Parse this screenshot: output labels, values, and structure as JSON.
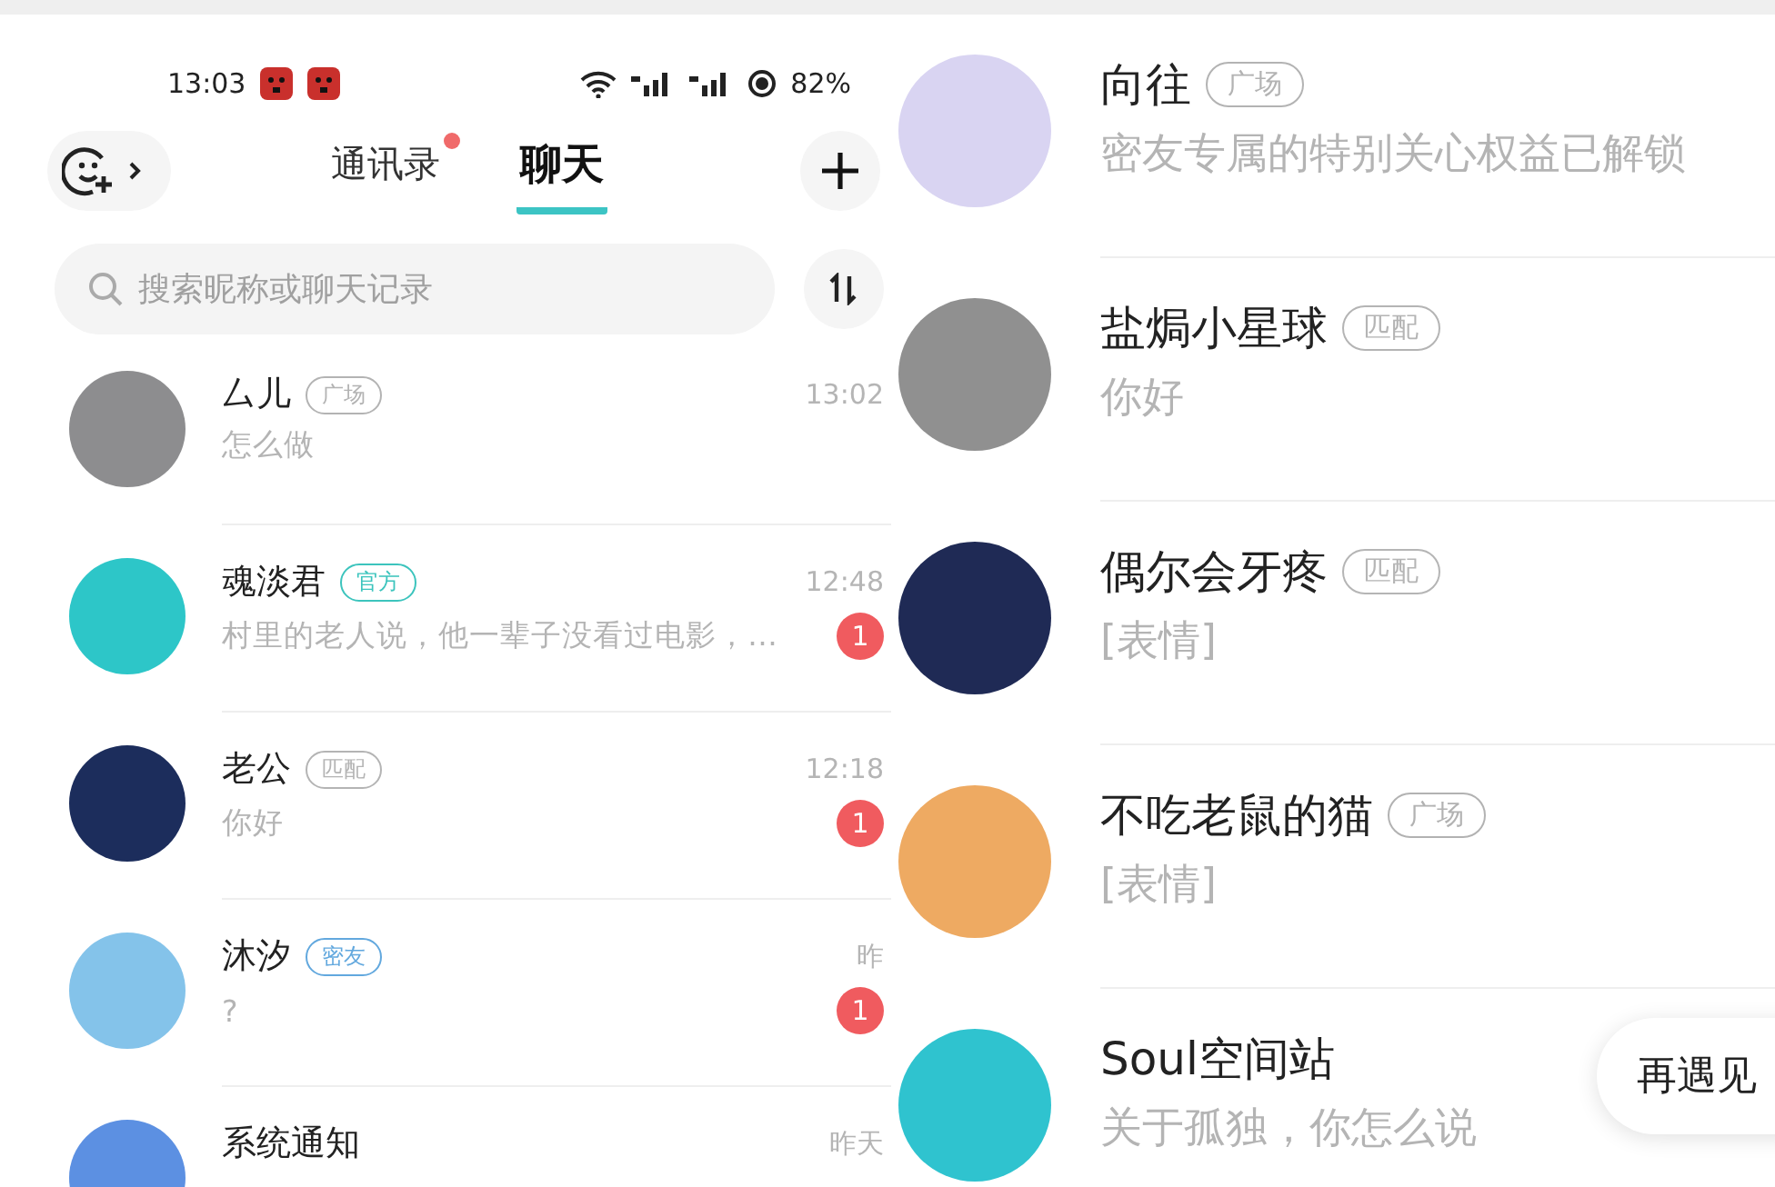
{
  "left": {
    "status_bar": {
      "time": "13:03",
      "battery": "82%"
    },
    "tabs": [
      {
        "label": "通讯录",
        "selected": false,
        "dot": true
      },
      {
        "label": "聊天",
        "selected": true,
        "dot": false
      }
    ],
    "search": {
      "placeholder": "搜索昵称或聊天记录"
    },
    "chats": [
      {
        "name": "厶儿",
        "tag": {
          "text": "广场",
          "color": "#b3b3b3"
        },
        "preview": "怎么做",
        "time": "13:02"
      },
      {
        "name": "魂淡君",
        "tag": {
          "text": "官方",
          "color": "#3cc4bd"
        },
        "preview": "村里的老人说，他一辈子没看过电影，…",
        "time": "12:48",
        "unread": "1"
      },
      {
        "name": "老公",
        "tag": {
          "text": "匹配",
          "color": "#b4b4b4"
        },
        "preview": "你好",
        "time": "12:18",
        "unread": "1"
      },
      {
        "name": "沐汐",
        "tag": {
          "text": "密友",
          "color": "#62a8de"
        },
        "preview": "?",
        "time": "昨",
        "unread": "1"
      },
      {
        "name": "系统通知",
        "time": "昨天"
      }
    ]
  },
  "right": {
    "chats": [
      {
        "name": "向往",
        "tag": {
          "text": "广场",
          "color": "#b3b3b3"
        },
        "preview": "密友专属的特别关心权益已解锁"
      },
      {
        "name": "盐焗小星球",
        "tag": {
          "text": "匹配",
          "color": "#b4b4b4"
        },
        "preview": "你好"
      },
      {
        "name": "偶尔会牙疼",
        "tag": {
          "text": "匹配",
          "color": "#b5b5b5"
        },
        "preview": "[表情]"
      },
      {
        "name": "不吃老鼠的猫",
        "tag": {
          "text": "广场",
          "color": "#b2b2b2"
        },
        "preview": "[表情]"
      },
      {
        "name": "Soul空间站",
        "preview": "关于孤独，你怎么说"
      }
    ],
    "floating_bubble": "再遇见"
  }
}
